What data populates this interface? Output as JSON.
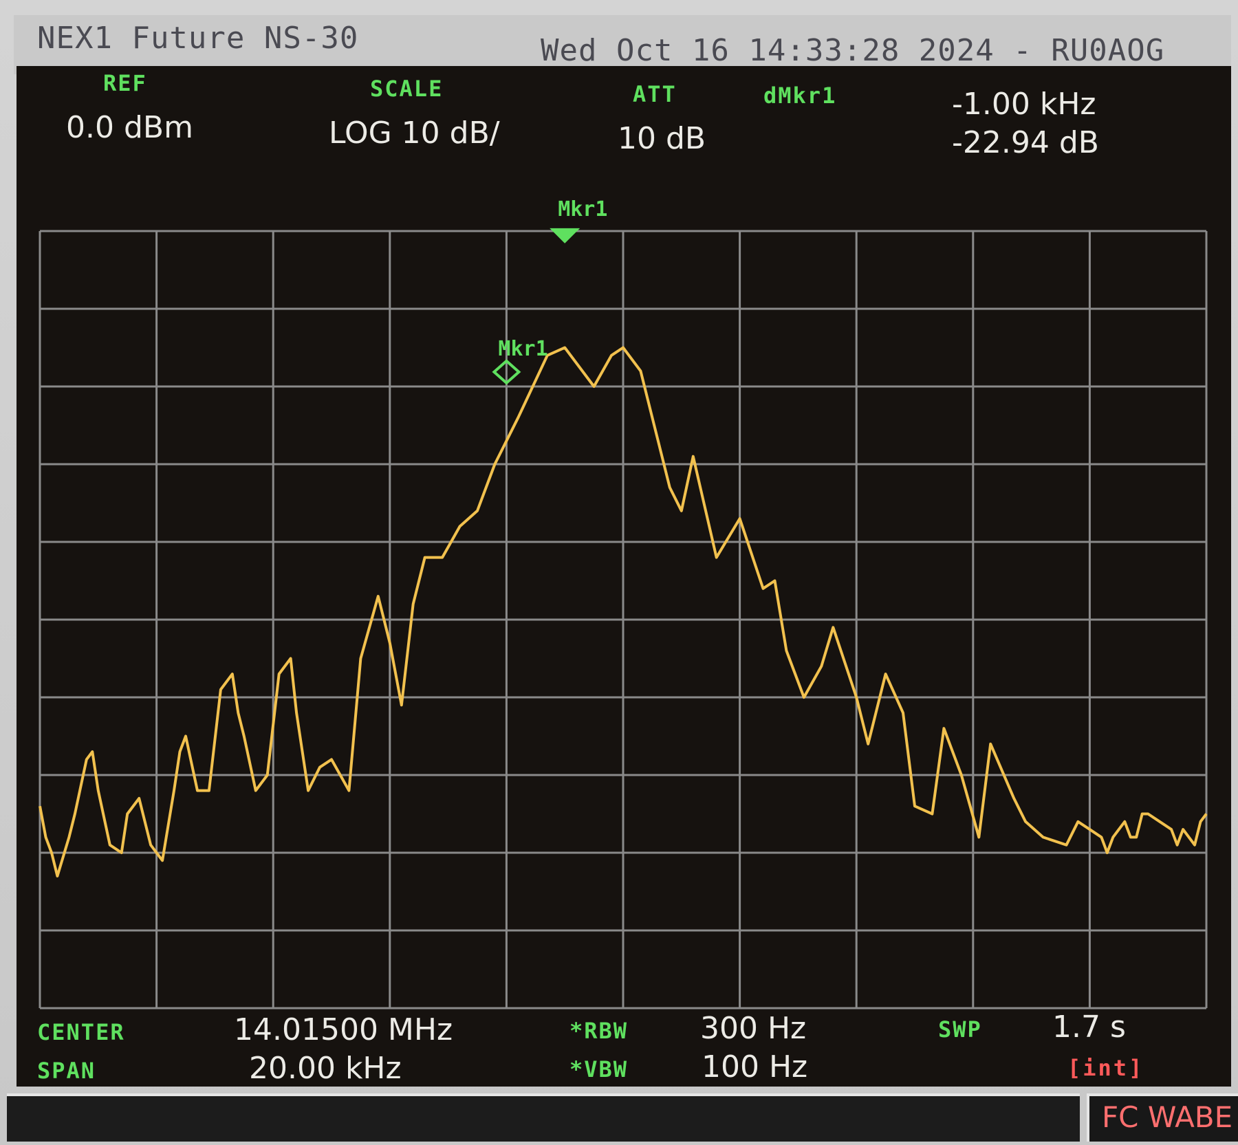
{
  "header": {
    "instrument": "NEX1 Future NS-30",
    "datetime": "Wed Oct 16 14:33:28 2024 - RU0AOG"
  },
  "readouts": {
    "ref_label": "REF",
    "ref_value": "0.0 dBm",
    "scale_label": "SCALE",
    "scale_value": "LOG 10 dB/",
    "att_label": "ATT",
    "att_value": "10 dB",
    "dmkr_label": "dMkr1",
    "dmkr_freq": "-1.00 kHz",
    "dmkr_level": "-22.94 dB"
  },
  "footer": {
    "center_label": "CENTER",
    "center_value": "14.01500 MHz",
    "span_label": "SPAN",
    "span_value": "20.00 kHz",
    "rbw_label": "*RBW",
    "rbw_value": "300 Hz",
    "vbw_label": "*VBW",
    "vbw_value": "100 Hz",
    "swp_label": "SWP",
    "swp_value": "1.7 s",
    "swp_mode": "[int]"
  },
  "status": {
    "fc_text": "FC WABE"
  },
  "markers": {
    "mkr_ref_label": "Mkr1",
    "mkr_delta_label": "Mkr1"
  },
  "colors": {
    "trace": "#f2c14e",
    "marker": "#5fe05f",
    "grid": "#8a8a8a",
    "screen": "#16120f"
  },
  "chart_data": {
    "type": "line",
    "xlabel": "",
    "ylabel": "",
    "x_unit": "kHz",
    "y_unit": "dBm",
    "xlim": [
      14005.0,
      14025.0
    ],
    "ylim": [
      -100,
      0
    ],
    "grid": true,
    "grid_divisions": {
      "x": 10,
      "y": 10
    },
    "series": [
      {
        "values_x": [
          0.0,
          0.1,
          0.2,
          0.3,
          0.5,
          0.6,
          0.8,
          0.9,
          1.0,
          1.2,
          1.4,
          1.5,
          1.7,
          1.9,
          2.1,
          2.3,
          2.4,
          2.5,
          2.7,
          2.9,
          3.1,
          3.3,
          3.4,
          3.5,
          3.7,
          3.9,
          4.1,
          4.3,
          4.4,
          4.6,
          4.8,
          5.0,
          5.3,
          5.5,
          5.8,
          6.0,
          6.2,
          6.4,
          6.6,
          6.9,
          7.2,
          7.5,
          7.8,
          8.2,
          8.7,
          9.0,
          9.5,
          9.8,
          10.0,
          10.3,
          10.8,
          11.0,
          11.2,
          11.6,
          12.0,
          12.4,
          12.6,
          12.8,
          13.1,
          13.4,
          13.6,
          14.0,
          14.2,
          14.5,
          14.8,
          15.0,
          15.3,
          15.5,
          15.8,
          16.1,
          16.3,
          16.7,
          16.9,
          17.2,
          17.6,
          17.8,
          18.0,
          18.2,
          18.3,
          18.4,
          18.5,
          18.6,
          18.7,
          18.8,
          18.9,
          19.0,
          19.2,
          19.4,
          19.5,
          19.6,
          19.8,
          19.9,
          20.0
        ],
        "values_y": [
          -74,
          -78,
          -80,
          -83,
          -78,
          -75,
          -68,
          -67,
          -72,
          -79,
          -80,
          -75,
          -73,
          -79,
          -81,
          -72,
          -67,
          -65,
          -72,
          -72,
          -59,
          -57,
          -62,
          -65,
          -72,
          -70,
          -57,
          -55,
          -62,
          -72,
          -69,
          -68,
          -72,
          -55,
          -47,
          -53,
          -61,
          -48,
          -42,
          -42,
          -38,
          -36,
          -30,
          -24,
          -16,
          -15,
          -20,
          -16,
          -15,
          -18,
          -33,
          -36,
          -29,
          -42,
          -37,
          -46,
          -45,
          -54,
          -60,
          -56,
          -51,
          -60,
          -66,
          -57,
          -62,
          -74,
          -75,
          -64,
          -70,
          -78,
          -66,
          -73,
          -76,
          -78,
          -79,
          -76,
          -77,
          -78,
          -80,
          -78,
          -77,
          -76,
          -78,
          -78,
          -75,
          -75,
          -76,
          -77,
          -79,
          -77,
          -79,
          -76,
          -75
        ]
      }
    ],
    "markers": [
      {
        "name": "Mkr1",
        "kind": "reference",
        "x": 14013.0,
        "y": -19.9
      },
      {
        "name": "Mkr1",
        "kind": "delta",
        "x": 14014.0,
        "y": -3.0
      }
    ]
  }
}
